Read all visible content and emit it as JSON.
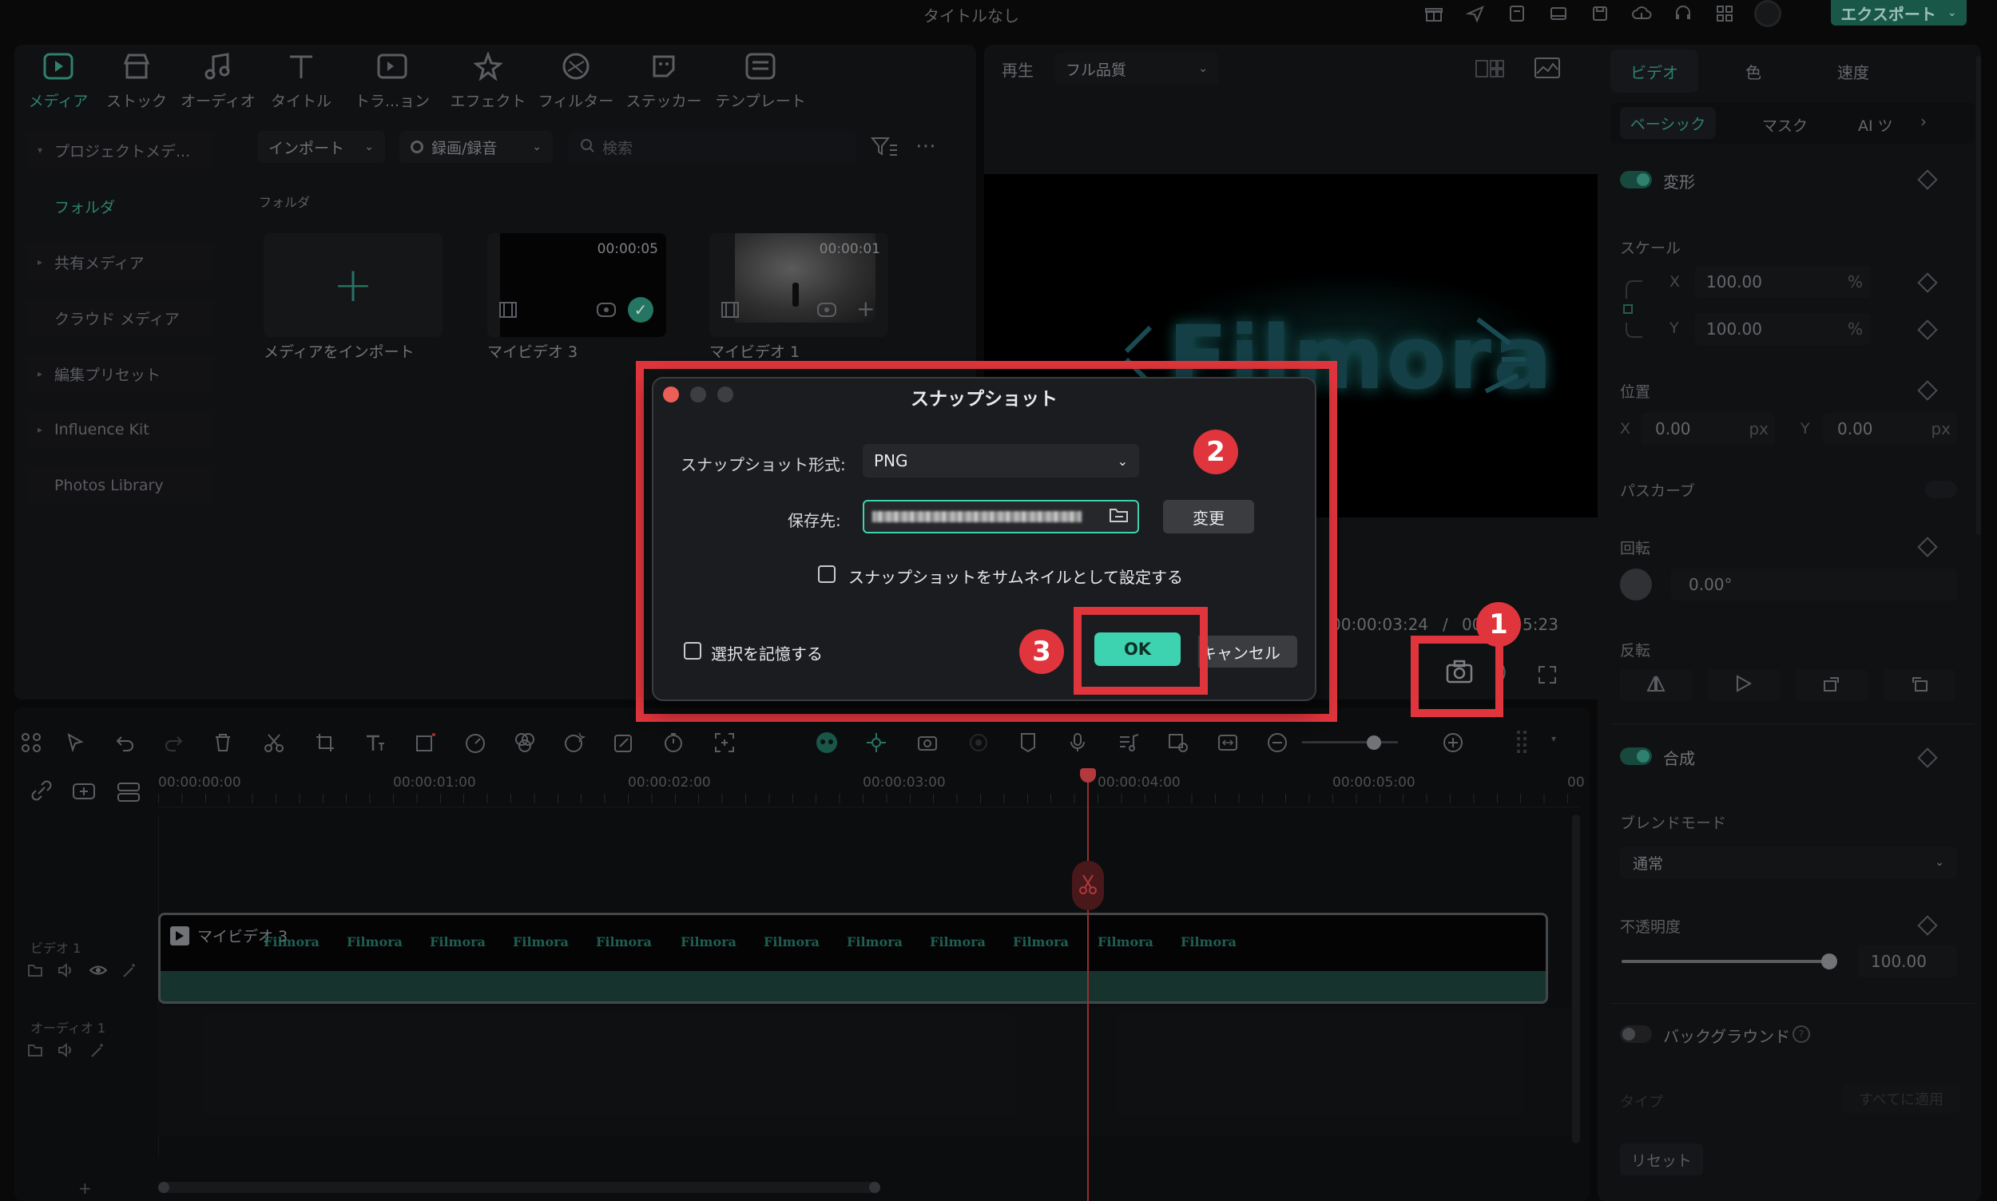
{
  "window": {
    "title": "タイトルなし",
    "export_label": "エクスポート"
  },
  "toolbar": [
    {
      "label": "メディア",
      "icon": "media-icon"
    },
    {
      "label": "ストック",
      "icon": "stock-icon"
    },
    {
      "label": "オーディオ",
      "icon": "audio-icon"
    },
    {
      "label": "タイトル",
      "icon": "title-icon"
    },
    {
      "label": "トラ...ョン",
      "icon": "transition-icon"
    },
    {
      "label": "エフェクト",
      "icon": "effect-icon"
    },
    {
      "label": "フィルター",
      "icon": "filter-icon"
    },
    {
      "label": "ステッカー",
      "icon": "sticker-icon"
    },
    {
      "label": "テンプレート",
      "icon": "template-icon"
    }
  ],
  "sidebar": {
    "items": [
      {
        "label": "プロジェクトメデ..."
      },
      {
        "label": "フォルダ"
      },
      {
        "label": "共有メディア"
      },
      {
        "label": "クラウド メディア"
      },
      {
        "label": "編集プリセット"
      },
      {
        "label": "Influence Kit"
      },
      {
        "label": "Photos Library"
      }
    ]
  },
  "media": {
    "import_label": "インポート",
    "record_label": "録画/録音",
    "search_placeholder": "検索",
    "folder_label": "フォルダ",
    "import_tile_label": "メディアをインポート",
    "clips": [
      {
        "name": "マイビデオ 3",
        "duration": "00:00:05"
      },
      {
        "name": "マイビデオ 1",
        "duration": "00:00:01"
      }
    ]
  },
  "preview": {
    "play_label": "再生",
    "quality": "フル品質",
    "current_time": "00:00:03:24",
    "separator": "/",
    "total_time_partial": "00",
    "total_time_tail": "5:23"
  },
  "right_panel": {
    "tabs": [
      "ビデオ",
      "色",
      "速度"
    ],
    "subtabs": [
      "ベーシック",
      "マスク",
      "AI ツ"
    ],
    "transform_label": "変形",
    "scale_label": "スケール",
    "scale_x": "100.00",
    "scale_y": "100.00",
    "percent_unit": "%",
    "position_label": "位置",
    "pos_x": "0.00",
    "pos_y": "0.00",
    "px_unit": "px",
    "axis_x": "X",
    "axis_y": "Y",
    "path_curve_label": "パスカーブ",
    "rotation_label": "回転",
    "rotation_value": "0.00°",
    "flip_label": "反転",
    "composite_label": "合成",
    "blend_mode_label": "ブレンドモード",
    "blend_mode_value": "通常",
    "opacity_label": "不透明度",
    "opacity_value": "100.00",
    "opacity_level": 1.0,
    "background_label": "バックグラウンド",
    "type_label": "タイプ",
    "apply_all_label": "すべてに適用",
    "reset_label": "リセット"
  },
  "timeline": {
    "ruler": [
      "00:00:00:00",
      "00:00:01:00",
      "00:00:02:00",
      "00:00:03:00",
      "00:00:04:00",
      "00:00:05:00",
      "00"
    ],
    "video_track_label": "ビデオ 1",
    "audio_track_label": "オーディオ 1",
    "clip_name": "マイビデオ 3",
    "frame_text": "Filmora",
    "zoom_level": 0.75
  },
  "preview_watermark": "Filmora",
  "dialog": {
    "title": "スナップショット",
    "format_label": "スナップショット形式:",
    "format_value": "PNG",
    "save_label": "保存先:",
    "change_button": "変更",
    "thumbnail_checkbox": "スナップショットをサムネイルとして設定する",
    "remember_checkbox": "選択を記憶する",
    "ok_button": "OK",
    "cancel_button": "キャンセル"
  },
  "annotations": [
    "1",
    "2",
    "3"
  ],
  "colors": {
    "accent": "#3dd3b0",
    "highlight_red": "#e0353c",
    "bg": "#0b0b0c",
    "panel": "#141517"
  }
}
